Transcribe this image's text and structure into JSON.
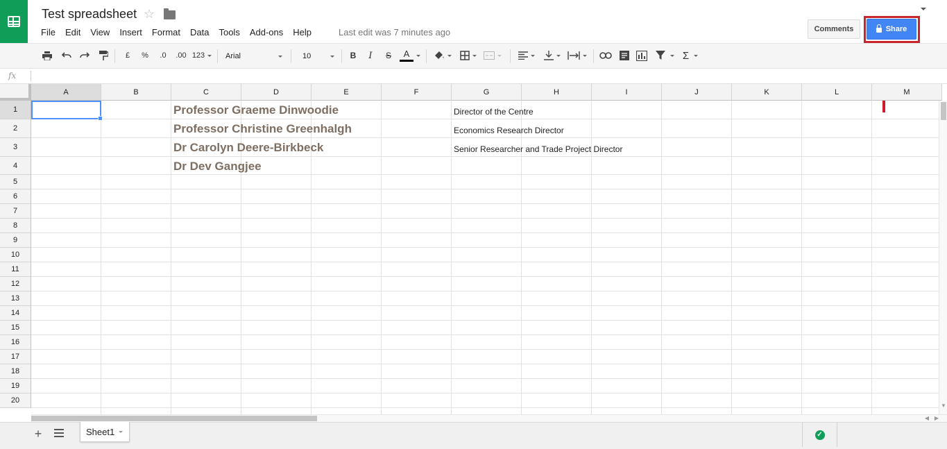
{
  "header": {
    "title": "Test spreadsheet",
    "menus": [
      "File",
      "Edit",
      "View",
      "Insert",
      "Format",
      "Data",
      "Tools",
      "Add-ons",
      "Help"
    ],
    "last_edit": "Last edit was 7 minutes ago",
    "comments_label": "Comments",
    "share_label": "Share",
    "annotation_color": "#d0192c"
  },
  "toolbar": {
    "currency": "£",
    "percent": "%",
    "decrease_decimals": ".0",
    "increase_decimals": ".00",
    "more_formats": "123",
    "font": "Arial",
    "font_size": "10",
    "bold": "B",
    "italic": "I",
    "strikethrough": "S",
    "text_color_letter": "A",
    "functions_symbol": "Σ"
  },
  "formula_bar": {
    "fx_label": "fx",
    "value": ""
  },
  "grid": {
    "columns": [
      "A",
      "B",
      "C",
      "D",
      "E",
      "F",
      "G",
      "H",
      "I",
      "J",
      "K",
      "L",
      "M"
    ],
    "rows": [
      "1",
      "2",
      "3",
      "4",
      "5",
      "6",
      "7",
      "8",
      "9",
      "10",
      "11",
      "12",
      "13",
      "14",
      "15",
      "16",
      "17",
      "18",
      "19",
      "20"
    ],
    "selected_cell": "A1",
    "names": [
      "Professor Graeme Dinwoodie",
      "Professor Christine Greenhalgh",
      "Dr Carolyn Deere-Birkbeck",
      "Dr Dev Gangjee"
    ],
    "titles": [
      "Director of the Centre",
      "Economics Research Director",
      "Senior Researcher and Trade Project Director"
    ]
  },
  "tabs": {
    "add_icon": "+",
    "sheets": [
      "Sheet1"
    ],
    "status": "saved-check-icon"
  },
  "colors": {
    "brand_green": "#0f9d58",
    "share_blue": "#4285f4",
    "name_text": "#7f6f62"
  }
}
